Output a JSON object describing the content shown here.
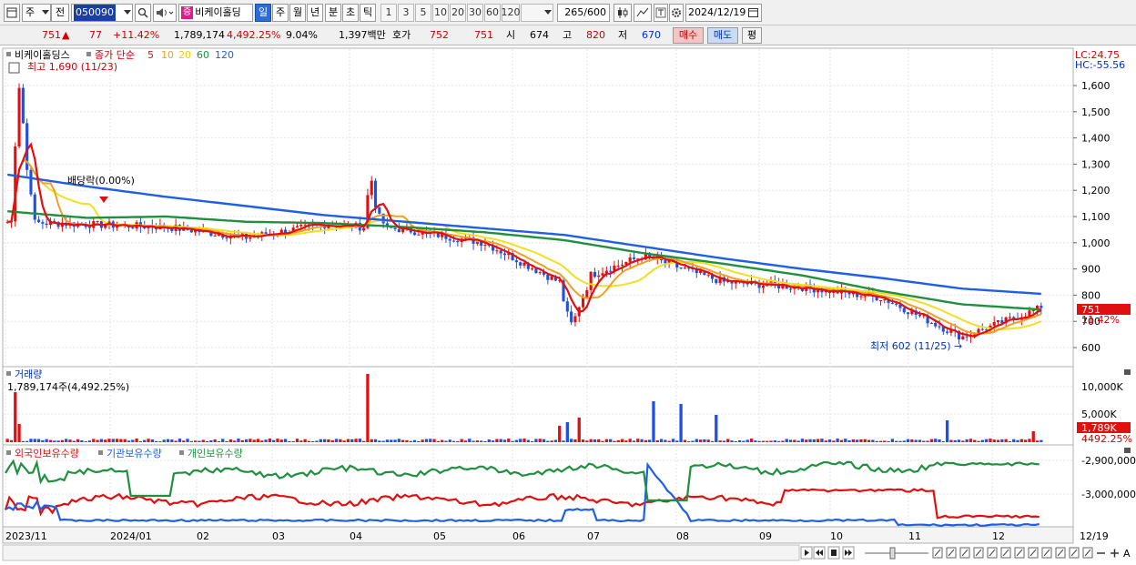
{
  "toolbar": {
    "market_type": "주",
    "prev_label": "전",
    "stock_code": "050090",
    "stock_tag": "증",
    "stock_name": "비케이홀딩",
    "period_buttons": [
      "일",
      "주",
      "월",
      "년",
      "분",
      "초",
      "틱"
    ],
    "selected_period": "일",
    "interval_buttons": [
      "1",
      "3",
      "5",
      "10",
      "20",
      "30",
      "60",
      "120"
    ],
    "count_value": "265",
    "count_total": "/600",
    "date": "2024/12/19"
  },
  "quote": {
    "price": "751",
    "change": "77",
    "change_pct": "+11.42%",
    "volume": "1,789,174",
    "volume_pct": "4,492.25%",
    "turnover_pct": "9.04%",
    "amount": "1,397백만",
    "hoga_label": "호가",
    "hoga_ask": "752",
    "hoga_bid": "751",
    "open_label": "시",
    "open": "674",
    "high_label": "고",
    "high": "820",
    "low_label": "저",
    "low": "670",
    "buy_label": "매수",
    "sell_label": "매도",
    "flat_label": "평"
  },
  "price_panel": {
    "title": "비케이홀딩스",
    "legend_prefix": "종가 단순",
    "ma_labels": [
      "5",
      "10",
      "20",
      "60",
      "120"
    ],
    "ma_colors": [
      "#e01010",
      "#f0a020",
      "#f0e020",
      "#209040",
      "#2060e0"
    ],
    "max_label": "최고 1,690 (11/23)",
    "min_label": "최저 602 (11/25)",
    "dividend_label": "배당락(0.00%)",
    "lc_label": "LC:24.75",
    "hc_label": "HC:-55.56",
    "price_tag": "751",
    "pct_tag": "11.42%",
    "y_ticks": [
      "1,600",
      "1,500",
      "1,400",
      "1,300",
      "1,200",
      "1,100",
      "1,000",
      "900",
      "800",
      "700",
      "600"
    ]
  },
  "volume_panel": {
    "title": "거래량",
    "value_label": "1,789,174주(4,492.25%)",
    "y_ticks": [
      "10,000K",
      "5,000K"
    ],
    "tag_value": "1,789K",
    "tag_pct": "4492.25%"
  },
  "holding_panel": {
    "series_labels": [
      "외국인보유수량",
      "기관보유수량",
      "개인보유수량"
    ],
    "series_colors": [
      "#e01010",
      "#2060e0",
      "#209040"
    ],
    "y_ticks": [
      "-2,900,000",
      "-3,000,000"
    ]
  },
  "x_axis": {
    "labels": [
      "2023/11",
      "2024/01",
      "02",
      "03",
      "04",
      "05",
      "06",
      "07",
      "08",
      "09",
      "10",
      "11",
      "12"
    ],
    "end_label": "12/19"
  },
  "chart_data": {
    "type": "line",
    "title": "비케이홀딩스",
    "x": [
      "2023/11",
      "2024/01",
      "02",
      "03",
      "04",
      "05",
      "06",
      "07",
      "08",
      "09",
      "10",
      "11",
      "12",
      "12/19"
    ],
    "series": [
      {
        "name": "120",
        "values": [
          1260,
          1215,
          1175,
          1140,
          1105,
          1080,
          1055,
          1030,
          985,
          940,
          900,
          865,
          825,
          805
        ]
      },
      {
        "name": "60",
        "values": [
          1120,
          1095,
          1100,
          1080,
          1075,
          1060,
          1040,
          1010,
          960,
          920,
          875,
          815,
          765,
          745
        ]
      },
      {
        "name": "5",
        "values": [
          1080,
          1070,
          1060,
          1020,
          1070,
          1050,
          1000,
          840,
          950,
          850,
          830,
          790,
          640,
          751
        ]
      }
    ],
    "ylim": [
      600,
      1690
    ],
    "max_value": 1690,
    "min_value": 602,
    "last_close": 751
  }
}
